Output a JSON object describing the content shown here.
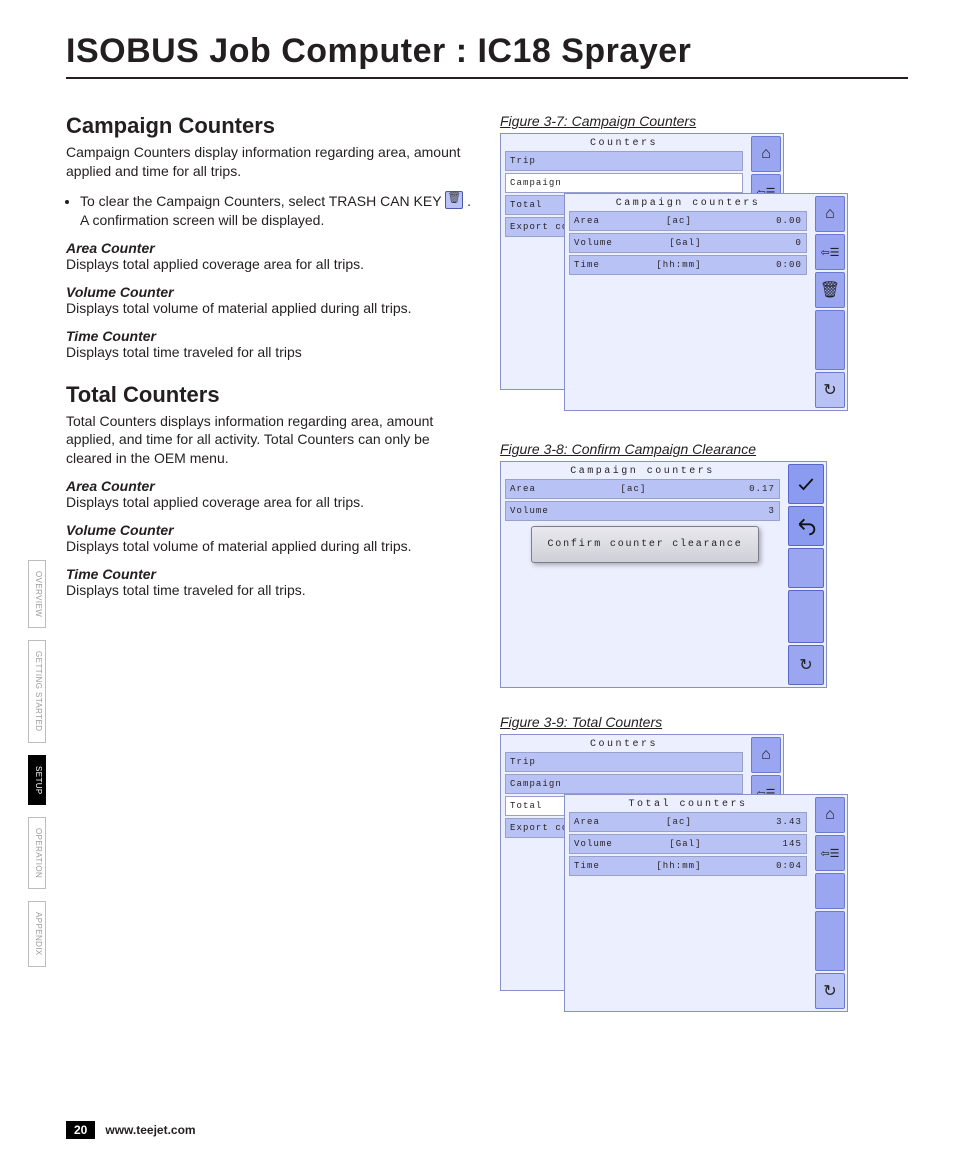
{
  "doc": {
    "title": "ISOBUS Job Computer : IC18 Sprayer",
    "page_number": "20",
    "footer_url": "www.teejet.com"
  },
  "side_tabs": [
    "OVERVIEW",
    "GETTING STARTED",
    "SETUP",
    "OPERATION",
    "APPENDIX"
  ],
  "active_tab_index": 2,
  "campaign": {
    "heading": "Campaign Counters",
    "intro": "Campaign Counters display information regarding area, amount applied and time for all trips.",
    "bullet": "To clear the Campaign Counters, select TRASH CAN KEY ",
    "bullet_tail": " . A confirmation screen will be displayed.",
    "area_h": "Area Counter",
    "area_p": "Displays total applied coverage area for all trips.",
    "vol_h": "Volume Counter",
    "vol_p": "Displays total volume of material applied during all trips.",
    "time_h": "Time Counter",
    "time_p": "Displays total time traveled for all trips"
  },
  "total": {
    "heading": "Total Counters",
    "intro": "Total Counters displays information regarding area, amount applied, and time for all activity.  Total Counters can only be cleared in the OEM menu.",
    "area_h": "Area Counter",
    "area_p": "Displays total applied coverage area for all trips.",
    "vol_h": "Volume Counter",
    "vol_p": "Displays total volume of material applied during all trips.",
    "time_h": "Time Counter",
    "time_p": "Displays total time traveled for all trips."
  },
  "fig37": {
    "caption": "Figure 3-7: Campaign Counters",
    "back": {
      "title": "Counters",
      "rows": [
        "Trip",
        "Campaign",
        "Total",
        "Export coun"
      ]
    },
    "selected_back_row": "Campaign",
    "front": {
      "title": "Campaign counters",
      "rows": [
        {
          "label": "Area",
          "unit": "[ac]",
          "value": "0.00"
        },
        {
          "label": "Volume",
          "unit": "[Gal]",
          "value": "0"
        },
        {
          "label": "Time",
          "unit": "[hh:mm]",
          "value": "0:00"
        }
      ]
    },
    "back_icons": [
      "home-icon",
      "back-icon"
    ],
    "front_icons": [
      "home-icon",
      "back-icon",
      "trash-icon",
      "",
      "refresh-icon"
    ]
  },
  "fig38": {
    "caption": "Figure 3-8: Confirm Campaign Clearance",
    "title": "Campaign counters",
    "rows": [
      {
        "label": "Area",
        "unit": "[ac]",
        "value": "0.17"
      },
      {
        "label": "Volume",
        "unit": "",
        "value": "3"
      }
    ],
    "dialog": "Confirm counter clearance",
    "icons": [
      "check-icon",
      "undo-icon",
      "",
      "",
      "refresh-icon"
    ]
  },
  "fig39": {
    "caption": "Figure 3-9: Total Counters",
    "back": {
      "title": "Counters",
      "rows": [
        "Trip",
        "Campaign",
        "Total",
        "Export coun"
      ]
    },
    "selected_back_row": "Total",
    "front": {
      "title": "Total counters",
      "rows": [
        {
          "label": "Area",
          "unit": "[ac]",
          "value": "3.43"
        },
        {
          "label": "Volume",
          "unit": "[Gal]",
          "value": "145"
        },
        {
          "label": "Time",
          "unit": "[hh:mm]",
          "value": "0:04"
        }
      ]
    },
    "back_icons": [
      "home-icon",
      "back-icon"
    ],
    "front_icons": [
      "home-icon",
      "back-icon",
      "",
      "",
      "refresh-icon"
    ]
  },
  "icons": {
    "home-icon": "⌂",
    "back-icon": "⇦☰",
    "trash-icon": "🗑",
    "refresh-icon": "↻",
    "check-icon": "✔",
    "undo-icon": "↶"
  }
}
